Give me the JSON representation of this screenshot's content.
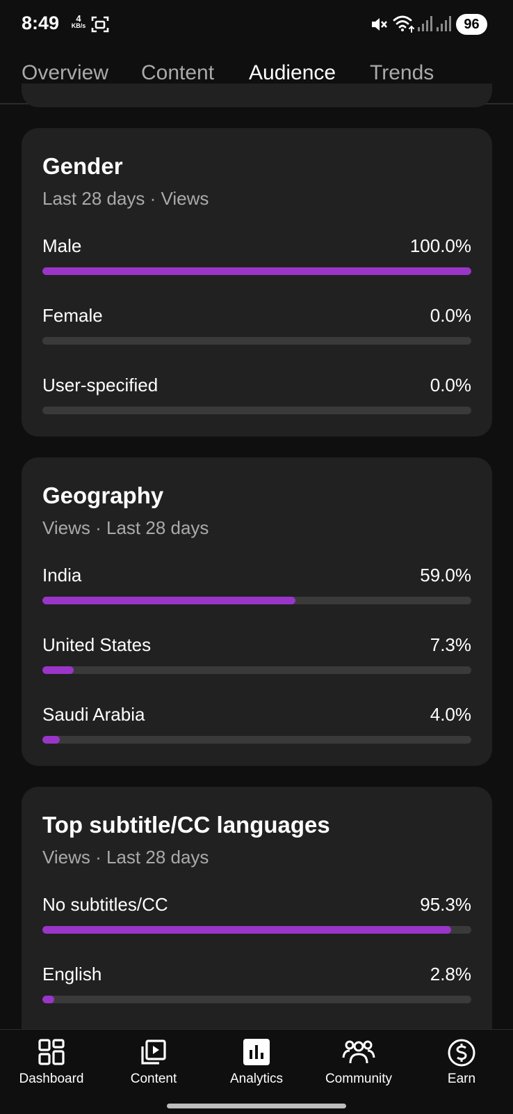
{
  "status_bar": {
    "time": "8:49",
    "net_speed_value": "4",
    "net_speed_unit": "KB/s",
    "battery": "96",
    "icons": [
      "screenshot-icon",
      "mute-icon",
      "wifi-icon",
      "signal-icon",
      "signal-icon"
    ]
  },
  "tabs": [
    {
      "label": "Overview",
      "active": false
    },
    {
      "label": "Content",
      "active": false
    },
    {
      "label": "Audience",
      "active": true
    },
    {
      "label": "Trends",
      "active": false
    }
  ],
  "cards": {
    "gender": {
      "title": "Gender",
      "subtitle": "Last 28 days · Views",
      "rows": [
        {
          "label": "Male",
          "value": "100.0%",
          "fraction": 1.0
        },
        {
          "label": "Female",
          "value": "0.0%",
          "fraction": 0.0
        },
        {
          "label": "User-specified",
          "value": "0.0%",
          "fraction": 0.0
        }
      ]
    },
    "geography": {
      "title": "Geography",
      "subtitle": "Views · Last 28 days",
      "rows": [
        {
          "label": "India",
          "value": "59.0%",
          "fraction": 0.59
        },
        {
          "label": "United States",
          "value": "7.3%",
          "fraction": 0.073
        },
        {
          "label": "Saudi Arabia",
          "value": "4.0%",
          "fraction": 0.04
        }
      ]
    },
    "subtitles": {
      "title": "Top subtitle/CC languages",
      "subtitle": "Views · Last 28 days",
      "rows": [
        {
          "label": "No subtitles/CC",
          "value": "95.3%",
          "fraction": 0.953
        },
        {
          "label": "English",
          "value": "2.8%",
          "fraction": 0.028
        }
      ]
    }
  },
  "bottom_nav": [
    {
      "label": "Dashboard",
      "icon": "dashboard-icon"
    },
    {
      "label": "Content",
      "icon": "content-icon"
    },
    {
      "label": "Analytics",
      "icon": "analytics-icon",
      "active": true
    },
    {
      "label": "Community",
      "icon": "community-icon"
    },
    {
      "label": "Earn",
      "icon": "earn-icon"
    }
  ],
  "colors": {
    "background": "#0f0f0f",
    "card": "#212121",
    "accent_bar": "#9a35c9",
    "bar_track": "#3a3a3a",
    "muted_text": "#aaaaaa"
  }
}
